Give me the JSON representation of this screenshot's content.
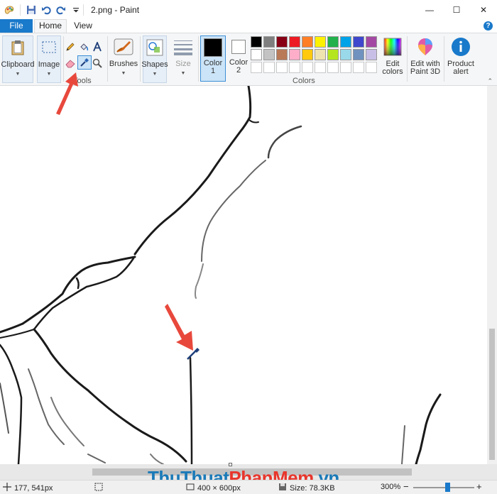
{
  "window": {
    "title": "2.png - Paint",
    "controls": {
      "minimize": "—",
      "maximize": "☐",
      "close": "✕"
    }
  },
  "tabs": {
    "file": "File",
    "home": "Home",
    "view": "View",
    "help": "?"
  },
  "ribbon": {
    "clipboard": "Clipboard",
    "image": "Image",
    "tools_group": "Tools",
    "brushes": "Brushes",
    "shapes": "Shapes",
    "size": "Size",
    "color1_line1": "Color",
    "color1_line2": "1",
    "color2_line1": "Color",
    "color2_line2": "2",
    "colors_group": "Colors",
    "edit_colors_line1": "Edit",
    "edit_colors_line2": "colors",
    "paint3d_line1": "Edit with",
    "paint3d_line2": "Paint 3D",
    "product_alert_line1": "Product",
    "product_alert_line2": "alert",
    "color1_value": "#000000",
    "color2_value": "#ffffff",
    "palette_row1": [
      "#000000",
      "#7f7f7f",
      "#880015",
      "#ed1c24",
      "#ff7f27",
      "#fff200",
      "#22b14c",
      "#00a2e8",
      "#3f48cc",
      "#a349a4"
    ],
    "palette_row2": [
      "#ffffff",
      "#c3c3c3",
      "#b97a57",
      "#ffaec9",
      "#ffc90e",
      "#efe4b0",
      "#b5e61d",
      "#99d9ea",
      "#7092be",
      "#c8bfe7"
    ],
    "palette_row3_empty_count": 10,
    "selected_tool": "color-picker-icon"
  },
  "status": {
    "cursor_position": "177, 541px",
    "image_dimensions": "400 × 600px",
    "file_size": "Size: 78.3KB",
    "zoom": "300%",
    "zoom_out": "−",
    "zoom_in": "+"
  },
  "watermark": {
    "part1": "ThuThuat",
    "part2": "PhanMem",
    "part3": ".vn"
  },
  "colors": {
    "accent": "#1979ca",
    "annotation_arrow": "#e8483c"
  }
}
